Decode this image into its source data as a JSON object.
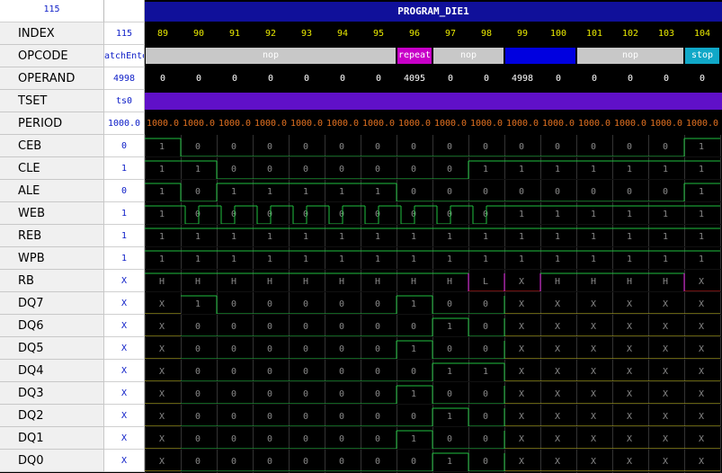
{
  "header": {
    "left_value": "115",
    "title": "PROGRAM_DIE1"
  },
  "columns": [
    "89",
    "90",
    "91",
    "92",
    "93",
    "94",
    "95",
    "96",
    "97",
    "98",
    "99",
    "100",
    "101",
    "102",
    "103",
    "104"
  ],
  "rows": [
    {
      "name": "INDEX",
      "value": "115"
    },
    {
      "name": "OPCODE",
      "value": "atchEnte"
    },
    {
      "name": "OPERAND",
      "value": "4998"
    },
    {
      "name": "TSET",
      "value": "ts0"
    },
    {
      "name": "PERIOD",
      "value": "1000.0"
    },
    {
      "name": "CEB",
      "value": "0"
    },
    {
      "name": "CLE",
      "value": "1"
    },
    {
      "name": "ALE",
      "value": "0"
    },
    {
      "name": "WEB",
      "value": "1"
    },
    {
      "name": "REB",
      "value": "1"
    },
    {
      "name": "WPB",
      "value": "1"
    },
    {
      "name": "RB",
      "value": "X"
    },
    {
      "name": "DQ7",
      "value": "X"
    },
    {
      "name": "DQ6",
      "value": "X"
    },
    {
      "name": "DQ5",
      "value": "X"
    },
    {
      "name": "DQ4",
      "value": "X"
    },
    {
      "name": "DQ3",
      "value": "X"
    },
    {
      "name": "DQ2",
      "value": "X"
    },
    {
      "name": "DQ1",
      "value": "X"
    },
    {
      "name": "DQ0",
      "value": "X"
    }
  ],
  "opcode_segments": [
    {
      "label": "nop",
      "start": 0,
      "span": 7,
      "color": "#c8c8c8"
    },
    {
      "label": "repeat",
      "start": 7,
      "span": 1,
      "color": "#c800c8"
    },
    {
      "label": "nop",
      "start": 8,
      "span": 2,
      "color": "#c8c8c8"
    },
    {
      "label": "",
      "start": 10,
      "span": 2,
      "color": "#0000e0"
    },
    {
      "label": "nop",
      "start": 12,
      "span": 3,
      "color": "#c8c8c8"
    },
    {
      "label": "stop",
      "start": 15,
      "span": 1,
      "color": "#10a8c8"
    }
  ],
  "operand_values": [
    "0",
    "0",
    "0",
    "0",
    "0",
    "0",
    "0",
    "4095",
    "0",
    "0",
    "4998",
    "0",
    "0",
    "0",
    "0",
    "0"
  ],
  "period_values": [
    "1000.0",
    "1000.0",
    "1000.0",
    "1000.0",
    "1000.0",
    "1000.0",
    "1000.0",
    "1000.0",
    "1000.0",
    "1000.0",
    "1000.0",
    "1000.0",
    "1000.0",
    "1000.0",
    "1000.0",
    "1000.0"
  ],
  "signals": {
    "CEB": [
      "1",
      "0",
      "0",
      "0",
      "0",
      "0",
      "0",
      "0",
      "0",
      "0",
      "0",
      "0",
      "0",
      "0",
      "0",
      "1"
    ],
    "CLE": [
      "1",
      "1",
      "0",
      "0",
      "0",
      "0",
      "0",
      "0",
      "0",
      "1",
      "1",
      "1",
      "1",
      "1",
      "1",
      "1"
    ],
    "ALE": [
      "1",
      "0",
      "1",
      "1",
      "1",
      "1",
      "1",
      "0",
      "0",
      "0",
      "0",
      "0",
      "0",
      "0",
      "0",
      "1"
    ],
    "WEB": [
      "1",
      "0",
      "0",
      "0",
      "0",
      "0",
      "0",
      "0",
      "0",
      "0",
      "1",
      "1",
      "1",
      "1",
      "1",
      "1"
    ],
    "REB": [
      "1",
      "1",
      "1",
      "1",
      "1",
      "1",
      "1",
      "1",
      "1",
      "1",
      "1",
      "1",
      "1",
      "1",
      "1",
      "1"
    ],
    "WPB": [
      "1",
      "1",
      "1",
      "1",
      "1",
      "1",
      "1",
      "1",
      "1",
      "1",
      "1",
      "1",
      "1",
      "1",
      "1",
      "1"
    ],
    "RB": [
      "H",
      "H",
      "H",
      "H",
      "H",
      "H",
      "H",
      "H",
      "H",
      "L",
      "X",
      "H",
      "H",
      "H",
      "H",
      "X"
    ],
    "DQ7": [
      "X",
      "1",
      "0",
      "0",
      "0",
      "0",
      "0",
      "1",
      "0",
      "0",
      "X",
      "X",
      "X",
      "X",
      "X",
      "X"
    ],
    "DQ6": [
      "X",
      "0",
      "0",
      "0",
      "0",
      "0",
      "0",
      "0",
      "1",
      "0",
      "X",
      "X",
      "X",
      "X",
      "X",
      "X"
    ],
    "DQ5": [
      "X",
      "0",
      "0",
      "0",
      "0",
      "0",
      "0",
      "1",
      "0",
      "0",
      "X",
      "X",
      "X",
      "X",
      "X",
      "X"
    ],
    "DQ4": [
      "X",
      "0",
      "0",
      "0",
      "0",
      "0",
      "0",
      "0",
      "1",
      "1",
      "X",
      "X",
      "X",
      "X",
      "X",
      "X"
    ],
    "DQ3": [
      "X",
      "0",
      "0",
      "0",
      "0",
      "0",
      "0",
      "1",
      "0",
      "0",
      "X",
      "X",
      "X",
      "X",
      "X",
      "X"
    ],
    "DQ2": [
      "X",
      "0",
      "0",
      "0",
      "0",
      "0",
      "0",
      "0",
      "1",
      "0",
      "X",
      "X",
      "X",
      "X",
      "X",
      "X"
    ],
    "DQ1": [
      "X",
      "0",
      "0",
      "0",
      "0",
      "0",
      "0",
      "1",
      "0",
      "0",
      "X",
      "X",
      "X",
      "X",
      "X",
      "X"
    ],
    "DQ0": [
      "X",
      "0",
      "0",
      "0",
      "0",
      "0",
      "0",
      "0",
      "1",
      "0",
      "X",
      "X",
      "X",
      "X",
      "X",
      "X"
    ]
  },
  "web_pulse_columns": [
    1,
    2,
    3,
    4,
    5,
    6,
    7,
    8,
    9
  ],
  "colors": {
    "title_bar": "#10109a",
    "tset_bar": "#6010c8",
    "column_number": "#e8e800",
    "wave": "#20c040",
    "rb_high": "#e020e0",
    "rb_low": "#e02020",
    "x_wave": "#c8c020",
    "label_value": "#1020c8",
    "period": "#e07020"
  }
}
